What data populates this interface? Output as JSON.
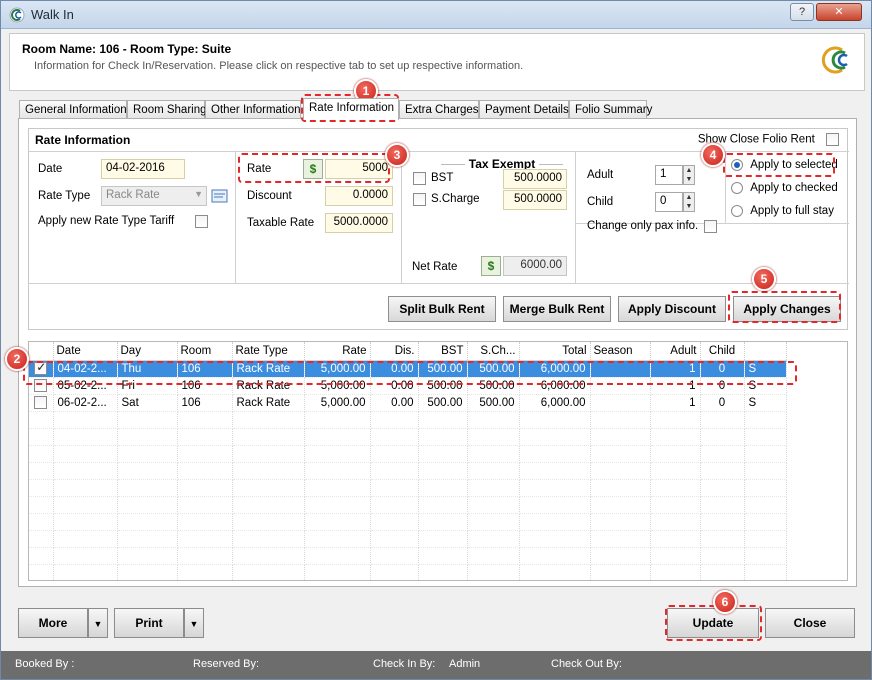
{
  "window": {
    "title": "Walk In",
    "help_label": "?",
    "close_label": "✕"
  },
  "header": {
    "room_name": "Room Name: 106 - Room Type: Suite",
    "subtitle": "Information for Check In/Reservation. Please click on respective tab to set up respective information."
  },
  "tabs": [
    {
      "label": "General Information"
    },
    {
      "label": "Room Sharing"
    },
    {
      "label": "Other Information"
    },
    {
      "label": "Rate Information",
      "active": true
    },
    {
      "label": "Extra Charges"
    },
    {
      "label": "Payment Details"
    },
    {
      "label": "Folio Summary"
    }
  ],
  "rate_info": {
    "title": "Rate Information",
    "show_close_folio_rent": "Show Close Folio Rent",
    "date_label": "Date",
    "date_value": "04-02-2016",
    "rate_type_label": "Rate Type",
    "rate_type_value": "Rack Rate",
    "apply_tariff_label": "Apply new Rate Type Tariff",
    "rate_label": "Rate",
    "rate_value": "5000",
    "discount_label": "Discount",
    "discount_value": "0.0000",
    "taxable_label": "Taxable Rate",
    "taxable_value": "5000.0000",
    "tax_exempt_label": "Tax Exempt",
    "bst_label": "BST",
    "bst_value": "500.0000",
    "scharge_label": "S.Charge",
    "scharge_value": "500.0000",
    "net_rate_label": "Net Rate",
    "net_rate_value": "6000.00",
    "adult_label": "Adult",
    "adult_value": "1",
    "child_label": "Child",
    "child_value": "0",
    "pax_only_label": "Change only pax info.",
    "apply_selected": "Apply to selected",
    "apply_checked": "Apply to checked",
    "apply_full": "Apply to full stay",
    "money_icon": "$"
  },
  "buttons": {
    "split": "Split Bulk Rent",
    "merge": "Merge Bulk Rent",
    "discount": "Apply Discount",
    "apply_changes": "Apply Changes",
    "more": "More",
    "print": "Print",
    "update": "Update",
    "close": "Close"
  },
  "grid": {
    "columns": [
      "Date",
      "Day",
      "Room",
      "Rate Type",
      "Rate",
      "Dis.",
      "BST",
      "S.Ch...",
      "Total",
      "Season",
      "Adult",
      "Child",
      ""
    ],
    "rows": [
      {
        "checked": true,
        "selected": true,
        "cells": [
          "04-02-2...",
          "Thu",
          "106",
          "Rack Rate",
          "5,000.00",
          "0.00",
          "500.00",
          "500.00",
          "6,000.00",
          "",
          "1",
          "0",
          "S"
        ]
      },
      {
        "checked": false,
        "selected": false,
        "cells": [
          "05-02-2...",
          "Fri",
          "106",
          "Rack Rate",
          "5,000.00",
          "0.00",
          "500.00",
          "500.00",
          "6,000.00",
          "",
          "1",
          "0",
          "S"
        ]
      },
      {
        "checked": false,
        "selected": false,
        "cells": [
          "06-02-2...",
          "Sat",
          "106",
          "Rack Rate",
          "5,000.00",
          "0.00",
          "500.00",
          "500.00",
          "6,000.00",
          "",
          "1",
          "0",
          "S"
        ]
      }
    ]
  },
  "status": {
    "booked_by": "Booked By :",
    "reserved_by": "Reserved By:",
    "check_in_by": "Check In By:",
    "check_in_value": "Admin",
    "check_out_by": "Check Out By:"
  },
  "callouts": [
    "1",
    "2",
    "3",
    "4",
    "5",
    "6"
  ]
}
